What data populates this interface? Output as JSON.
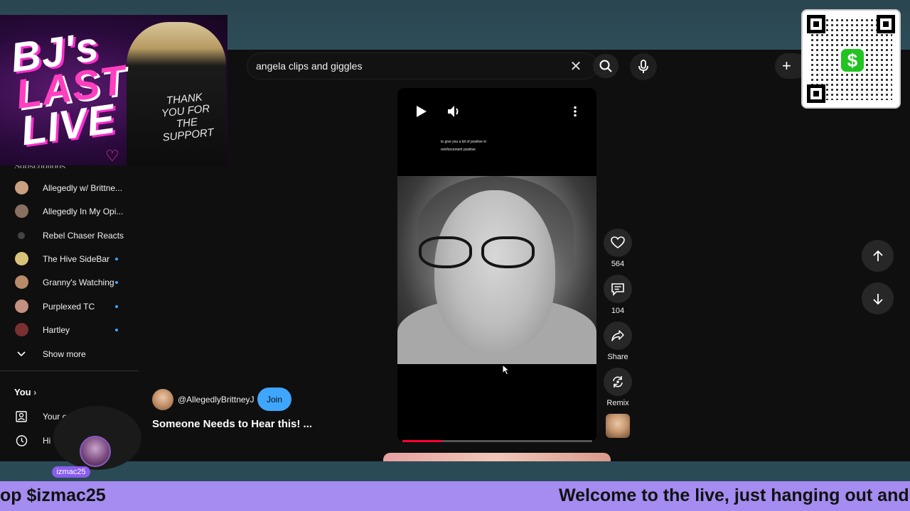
{
  "search": {
    "query": "angela clips and giggles"
  },
  "banner": {
    "title_line1": "BJ's",
    "title_line2": "LAST",
    "title_line3": "LIVE",
    "jacket_text": "THANK YOU FOR THE SUPPORT"
  },
  "sidebar": {
    "subscriptions_header": "Subscriptions",
    "items": [
      {
        "label": "Allegedly w/ Brittne...",
        "new": false,
        "color": "#c9a080"
      },
      {
        "label": "Allegedly In My Opi...",
        "new": false,
        "color": "#8a7060"
      },
      {
        "label": "Rebel Chaser Reacts",
        "new": false,
        "color": "#444444"
      },
      {
        "label": "The Hive SideBar",
        "new": true,
        "color": "#d9c27a"
      },
      {
        "label": "Granny's Watching",
        "new": true,
        "color": "#b88a6a"
      },
      {
        "label": "Purplexed TC",
        "new": true,
        "color": "#c49080"
      },
      {
        "label": "Hartley",
        "new": true,
        "color": "#7a3030"
      }
    ],
    "show_more": "Show more",
    "you_header": "You",
    "you_items": [
      {
        "label": "Your c"
      },
      {
        "label": "Hi"
      }
    ]
  },
  "video": {
    "caption_line1": "to give you a bit of positive in",
    "caption_line2": "reinforcement positive",
    "progress": 0.21
  },
  "actions": {
    "likes": "564",
    "comments": "104",
    "share": "Share",
    "remix": "Remix"
  },
  "channel": {
    "handle": "@AllegedlyBrittneyJ",
    "join": "Join",
    "title": "Someone Needs to Hear this! ..."
  },
  "webcam": {
    "tag": "izmac25"
  },
  "ticker": {
    "left_text": "op $izmac25",
    "right_text": "Welcome to the live, just hanging out and"
  },
  "colors": {
    "accent_blue": "#3ea6ff",
    "ticker_bg": "#a48cf0",
    "progress_red": "#ff0033",
    "cashapp_green": "#22c322"
  }
}
